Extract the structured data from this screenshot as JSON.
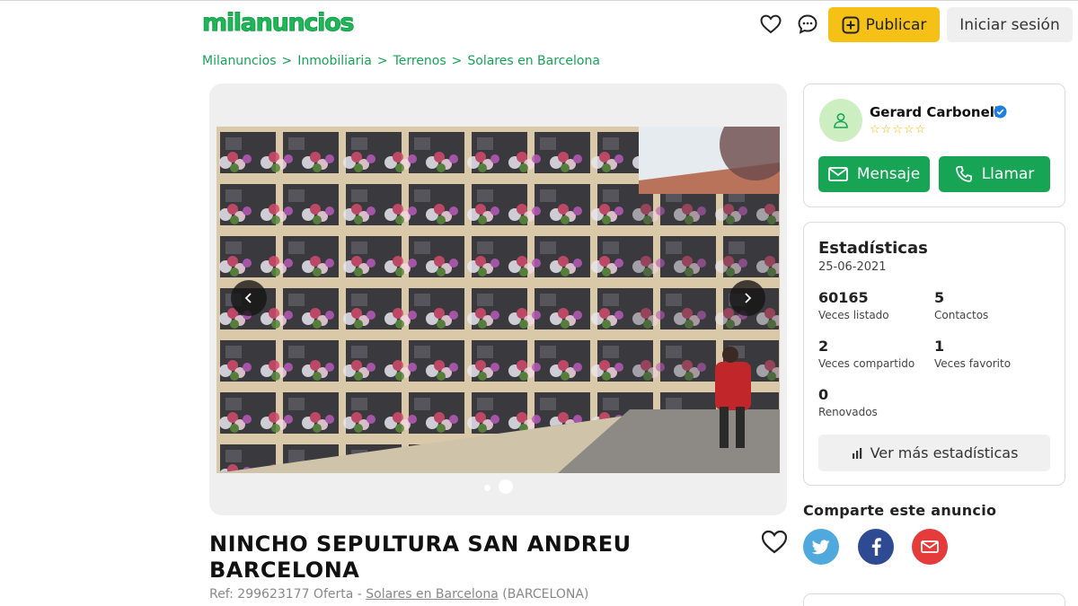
{
  "header": {
    "logo": "milanuncios",
    "publish_label": "Publicar",
    "login_label": "Iniciar sesión"
  },
  "breadcrumb": {
    "items": [
      "Milanuncios",
      "Inmobiliaria",
      "Terrenos",
      "Solares en Barcelona"
    ],
    "separator": ">"
  },
  "gallery": {
    "image_count": 2,
    "active_index": 2
  },
  "listing": {
    "title_line1": "NINCHO SEPULTURA SAN ANDREU",
    "title_line2": "BARCELONA",
    "ref_prefix": "Ref: 299623177 Oferta - ",
    "ref_category": "Solares en Barcelona",
    "ref_location": " (BARCELONA)"
  },
  "seller": {
    "name": "Gerard Carbonell",
    "rating": "☆☆☆☆☆",
    "message_label": "Mensaje",
    "call_label": "Llamar"
  },
  "stats": {
    "title": "Estadísticas",
    "date": "25-06-2021",
    "items": [
      {
        "value": "60165",
        "label": "Veces listado"
      },
      {
        "value": "5",
        "label": "Contactos"
      },
      {
        "value": "2",
        "label": "Veces compartido"
      },
      {
        "value": "1",
        "label": "Veces favorito"
      },
      {
        "value": "0",
        "label": "Renovados"
      }
    ],
    "more_label": "Ver más estadísticas"
  },
  "share": {
    "title": "Comparte este anuncio",
    "networks": [
      "twitter-icon",
      "facebook-icon",
      "mail-icon"
    ]
  },
  "colors": {
    "brand_green": "#1fb859",
    "button_green": "#18a455",
    "publish_yellow": "#f5c117",
    "twitter": "#4fa9dc",
    "facebook": "#2e4a93",
    "mail": "#e63b3b"
  }
}
